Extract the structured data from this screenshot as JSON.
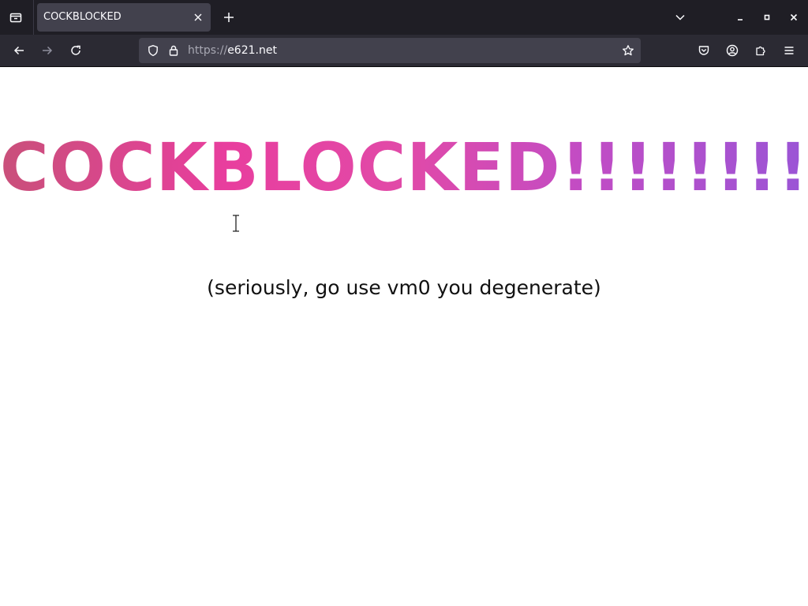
{
  "browser": {
    "tab": {
      "title": "COCKBLOCKED"
    },
    "url": {
      "scheme": "https://",
      "host": "e621.net"
    }
  },
  "page": {
    "headline": "COCKBLOCKED!!!!!!!!",
    "subline": "(seriously, go use vm0 you degenerate)"
  },
  "colors": {
    "tabstrip_bg": "#1f1e25",
    "toolbar_bg": "#2b2a33",
    "urlbar_bg": "#42414d",
    "headline_gradient_start": "#c9507a",
    "headline_gradient_mid": "#e83e9e",
    "headline_gradient_end": "#9a55d6"
  },
  "icons": {
    "tab_list": "tab-list-icon",
    "tab_close": "close-icon",
    "new_tab": "plus-icon",
    "list_all_tabs": "chevron-down-icon",
    "minimize": "minimize-icon",
    "maximize": "maximize-icon",
    "close_window": "close-icon",
    "back": "arrow-left-icon",
    "forward": "arrow-right-icon",
    "reload": "reload-icon",
    "tracking_protection": "shield-icon",
    "secure_connection": "lock-icon",
    "bookmark": "star-icon",
    "pocket": "pocket-icon",
    "account": "account-icon",
    "extensions": "puzzle-icon",
    "app_menu": "hamburger-icon"
  }
}
